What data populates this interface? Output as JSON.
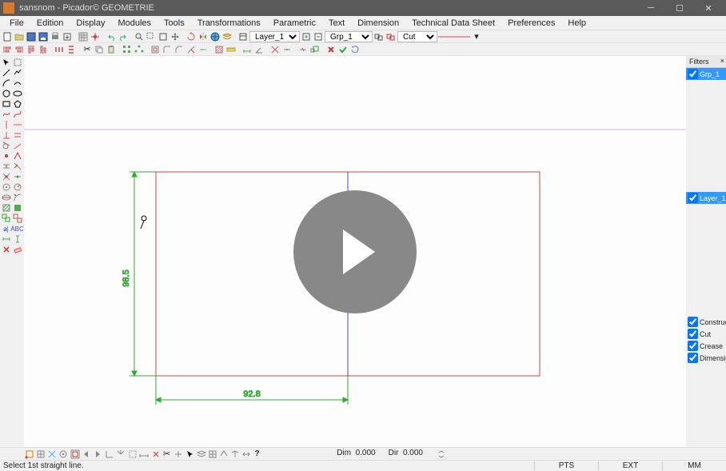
{
  "title": "sansnom - Picador© GEOMETRIE",
  "menu": [
    "File",
    "Edition",
    "Display",
    "Modules",
    "Tools",
    "Transformations",
    "Parametric",
    "Text",
    "Dimension",
    "Technical Data Sheet",
    "Preferences",
    "Help"
  ],
  "toolbar1": {
    "layer_dropdown": "Layer_1",
    "group_dropdown": "Grp_1",
    "type_dropdown": "Cut"
  },
  "right": {
    "filters_title": "Filters",
    "group_item": "Grp_1",
    "layer_item": "Layer_1",
    "line_types": [
      "Construction",
      "Cut",
      "Crease",
      "Dimension"
    ]
  },
  "drawing": {
    "dim_vertical": "98.5",
    "dim_horizontal": "92.8"
  },
  "readout": {
    "dim_label": "Dim",
    "dim_val": "0.000",
    "dir_label": "Dir",
    "dir_val": "0.000"
  },
  "status": {
    "hint": "Select 1st straight line.",
    "pts": "PTS",
    "ext": "EXT",
    "mm": "MM"
  }
}
